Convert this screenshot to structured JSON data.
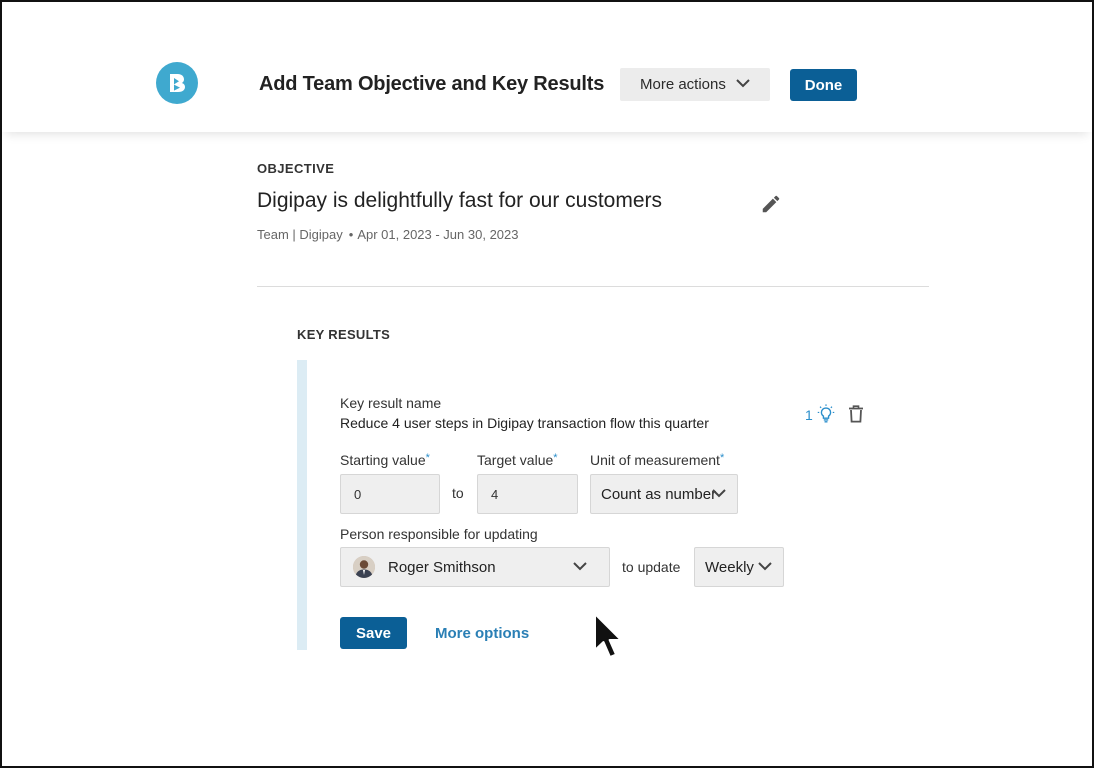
{
  "header": {
    "title": "Add Team Objective and Key Results",
    "more_actions_label": "More actions",
    "done_label": "Done",
    "logo_icon": "brand-b-logo"
  },
  "objective": {
    "section_label": "OBJECTIVE",
    "title": "Digipay is delightfully fast for our customers",
    "team": "Team | Digipay",
    "separator": "•",
    "date_range": "Apr 01, 2023 - Jun 30, 2023"
  },
  "key_results": {
    "section_label": "KEY RESULTS",
    "items": [
      {
        "name_label": "Key result name",
        "name_value": "Reduce 4 user steps in Digipay transaction flow this quarter",
        "idea_count": "1",
        "starting_value_label": "Starting value",
        "starting_value": "0",
        "to_text": "to",
        "target_value_label": "Target value",
        "target_value": "4",
        "unit_label": "Unit of measurement",
        "unit_value": "Count as number",
        "required_mark": "*",
        "person_label": "Person responsible for updating",
        "person_value": "Roger Smithson",
        "to_update_text": "to update",
        "frequency_value": "Weekly",
        "save_label": "Save",
        "more_options_label": "More options"
      }
    ]
  },
  "colors": {
    "primary": "#0b5f96",
    "link": "#2a7fb5",
    "logo": "#3fa9cf",
    "accent_bar": "#dcecf4"
  }
}
